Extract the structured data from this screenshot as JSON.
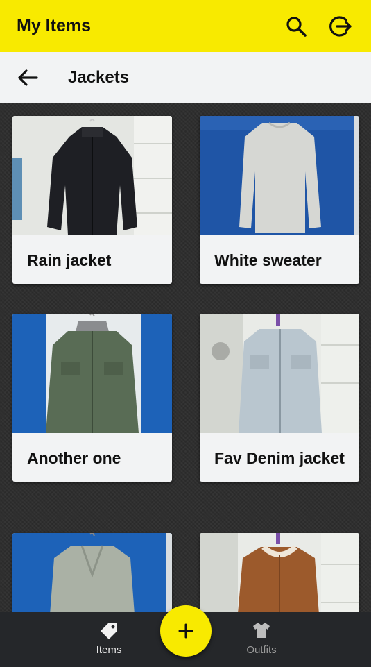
{
  "appbar": {
    "title": "My Items",
    "icons": [
      "search-icon",
      "logout-icon"
    ]
  },
  "subbar": {
    "back_icon": "arrow-back-icon",
    "title": "Jackets"
  },
  "items": [
    {
      "label": "Rain jacket"
    },
    {
      "label": "White sweater"
    },
    {
      "label": "Another one"
    },
    {
      "label": "Fav Denim jacket"
    },
    {
      "label": ""
    },
    {
      "label": ""
    }
  ],
  "bottom_nav": {
    "items_label": "Items",
    "outfits_label": "Outfits",
    "fab_icon": "plus-icon"
  },
  "colors": {
    "accent": "#f8ea00",
    "nav_background": "#25272a"
  }
}
